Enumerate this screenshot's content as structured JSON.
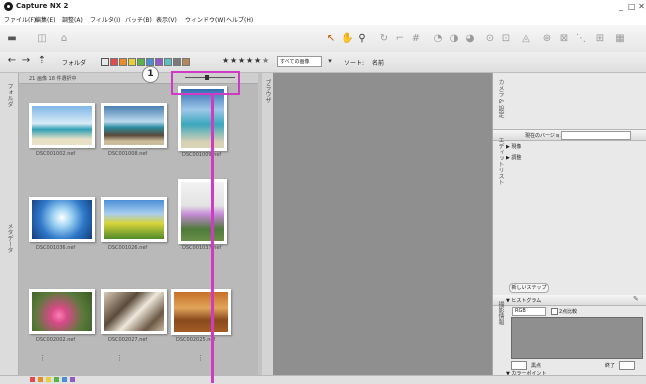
{
  "app": {
    "title": "Capture NX 2"
  },
  "window_controls": {
    "minimize": "_",
    "close": "□ ✕"
  },
  "menu": [
    "ファイル(F)",
    "編集(E)",
    "調整(A)",
    "フィルタ(I)",
    "バッチ(B)",
    "表示(V)",
    "ウィンドウ(W)",
    "ヘルプ(H)"
  ],
  "toolbar2": {
    "folder_label": "フォルダ",
    "filter_select": "すべての画像",
    "sort_label": "ソート:",
    "sort_value": "名前"
  },
  "browser": {
    "header_status": "21 画像  18 件選択中",
    "thumbnails": [
      {
        "caption": "DSC001002.nef"
      },
      {
        "caption": "DSC001008.nef"
      },
      {
        "caption": "DSC001009.nef"
      },
      {
        "caption": "DSC001036.nef"
      },
      {
        "caption": "DSC001026.nef"
      },
      {
        "caption": "DSC001037.nef"
      },
      {
        "caption": "DSC002002.nef"
      },
      {
        "caption": "DSC002027.nef"
      },
      {
        "caption": "DSC002025.nef"
      }
    ],
    "left_strip_label_top": "フォルダ",
    "left_strip_label_bottom": "メタデータ",
    "vstrip_label": "ブラウザ"
  },
  "callout": {
    "number": "1"
  },
  "right_panel": {
    "top_strip_label": "カメラ & 設定",
    "strip2_label": "エディットリスト",
    "version_label": "現在のバージョン",
    "tree_items": [
      "▶ 現像",
      "▶ 調整"
    ],
    "new_step_button": "新しいステップ",
    "histogram_title": "▼ ヒストグラム",
    "histogram_channel": "RGB",
    "histogram_option": "2点比較",
    "histogram_side_label": "撮影情報",
    "level_label_left": "黒点",
    "level_label_right": "終了",
    "color_picker_label": "▼ カラーポイント"
  },
  "colors": {
    "accent": "#cf3bc2",
    "viewer_bg": "#8f8f8f",
    "browser_bg": "#b9b9b9"
  }
}
